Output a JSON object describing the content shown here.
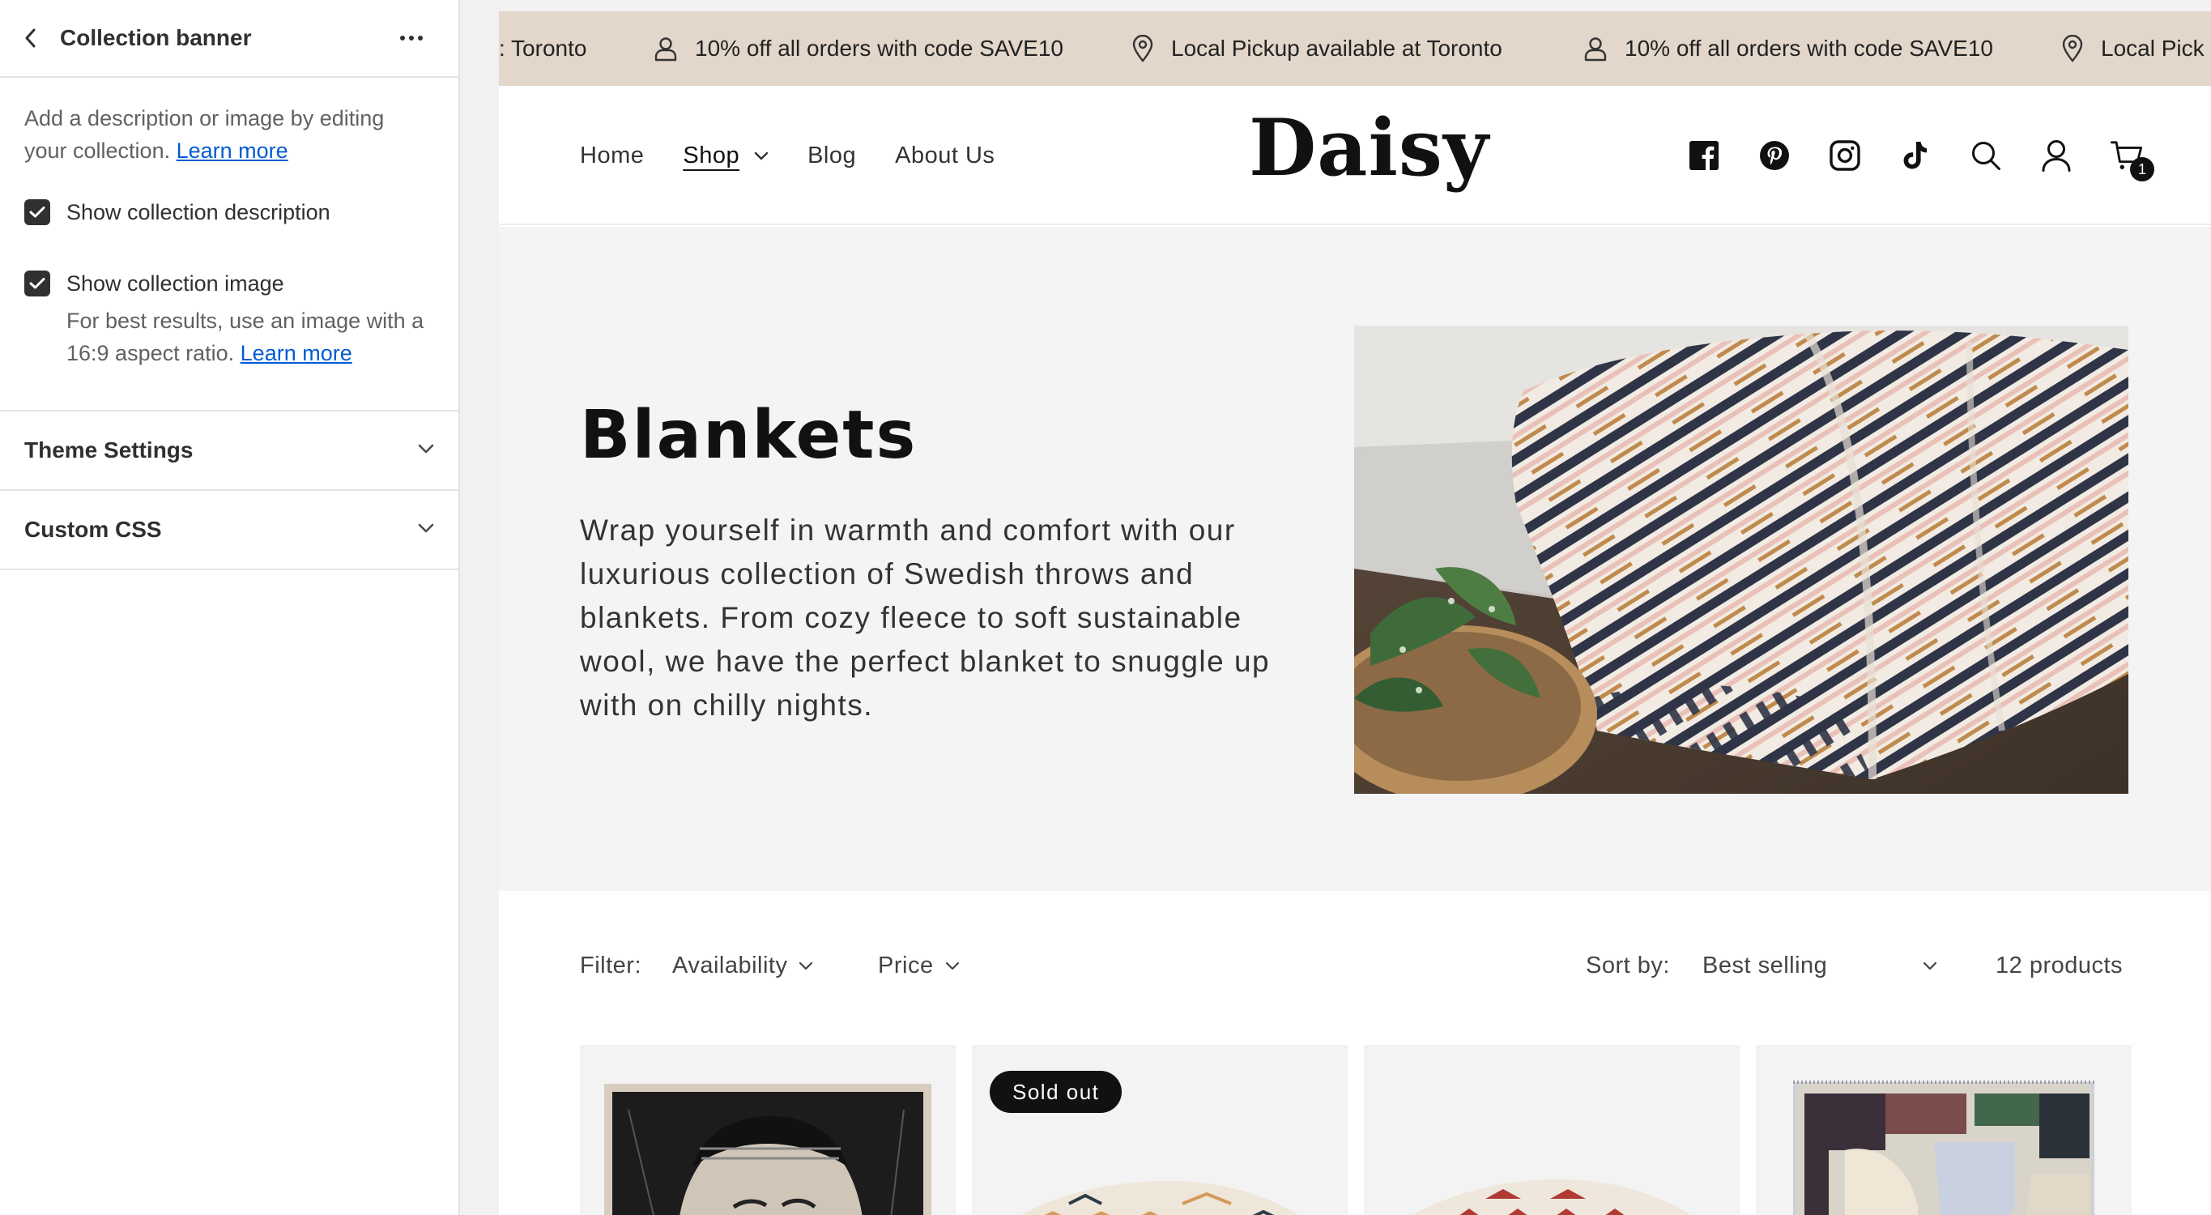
{
  "sidebar": {
    "title": "Collection banner",
    "description": "Add a description or image by editing your collection.",
    "learn_more": "Learn more",
    "checkbox_description": "Show collection description",
    "checkbox_image": "Show collection image",
    "image_help": "For best results, use an image with a 16:9 aspect ratio.",
    "image_help_link": "Learn more",
    "section_theme": "Theme Settings",
    "section_css": "Custom CSS"
  },
  "announcement": {
    "items": [
      ": Toronto",
      "10% off all orders with code SAVE10",
      "Local Pickup available at Toronto",
      "10% off all orders with code SAVE10",
      "Local Pick"
    ]
  },
  "store": {
    "logo": "Daisy",
    "nav": [
      "Home",
      "Shop",
      "Blog",
      "About Us"
    ],
    "cart_count": "1"
  },
  "collection": {
    "title": "Blankets",
    "description": " Wrap yourself in warmth and comfort with our luxurious collection of Swedish throws and blankets. From cozy fleece to soft sustainable wool, we have the perfect blanket to snuggle up with on chilly nights."
  },
  "filters": {
    "filter_label": "Filter:",
    "availability": "Availability",
    "price": "Price",
    "sort_label": "Sort by:",
    "sort_value": "Best selling",
    "product_count": "12 products"
  },
  "products": {
    "sold_out_badge": "Sold out"
  },
  "colors": {
    "announcement_bg": "#e3d6ca",
    "banner_bg": "#f4f4f4",
    "link": "#005bd3",
    "badge_bg": "#111111"
  }
}
